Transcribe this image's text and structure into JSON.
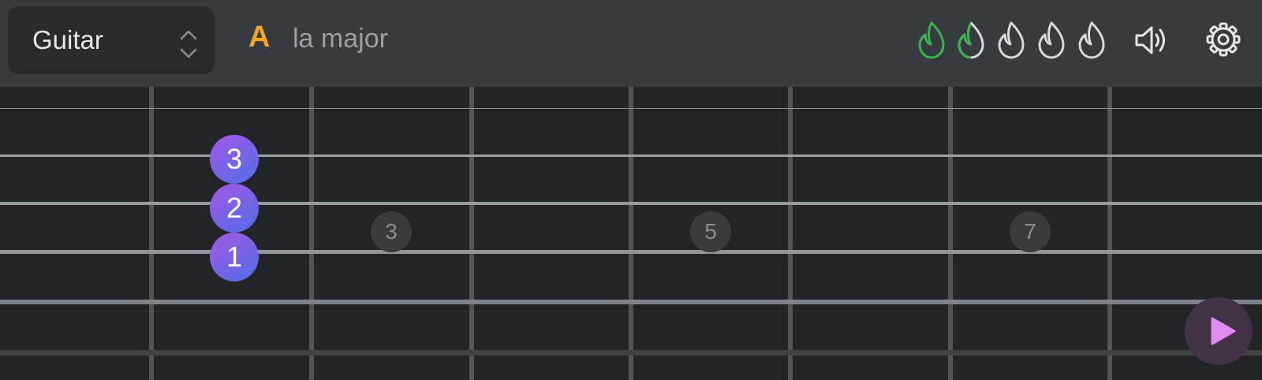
{
  "header": {
    "instrument": "Guitar",
    "chord_root": "A",
    "chord_name": "la major",
    "streak": {
      "total": 5,
      "active_full": 1,
      "active_partial_fraction": 0.5,
      "active_color": "#3cb44b",
      "inactive_color": "#d8dadd",
      "icon": "flame-icon"
    },
    "sound_icon": "speaker-icon",
    "settings_icon": "gear-icon"
  },
  "fretboard": {
    "fret_markers": [
      "3",
      "5",
      "7"
    ],
    "fingers": [
      {
        "label": "3",
        "fret": 1,
        "string": 3
      },
      {
        "label": "2",
        "fret": 1,
        "string": 4
      },
      {
        "label": "1",
        "fret": 1,
        "string": 5
      }
    ],
    "finger_gradient": [
      "#a558e6",
      "#4f6ee6"
    ]
  },
  "play_button": {
    "icon": "play-icon",
    "color": "#e08cf2"
  }
}
